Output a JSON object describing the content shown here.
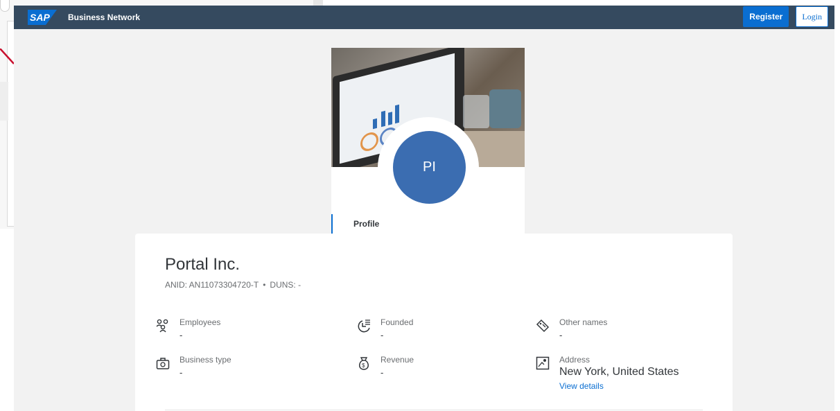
{
  "shellbar": {
    "logo_text": "SAP",
    "title": "Business Network",
    "register_label": "Register",
    "login_label": "Login",
    "background": "#354a5f",
    "accent": "#0a6ed1"
  },
  "profile": {
    "avatar_initials": "PI",
    "avatar_color": "#3b6db1",
    "tab_label": "Profile"
  },
  "company": {
    "name": "Portal Inc.",
    "anid_label": "ANID: AN11073304720-T",
    "separator": "•",
    "duns_label": "DUNS: -"
  },
  "fields": {
    "employees": {
      "label": "Employees",
      "value": "-",
      "icon": "employees-icon"
    },
    "founded": {
      "label": "Founded",
      "value": "-",
      "icon": "founded-icon"
    },
    "other_names": {
      "label": "Other names",
      "value": "-",
      "icon": "tag-icon"
    },
    "business_type": {
      "label": "Business type",
      "value": "-",
      "icon": "briefcase-icon"
    },
    "revenue": {
      "label": "Revenue",
      "value": "-",
      "icon": "money-bag-icon"
    },
    "address": {
      "label": "Address",
      "value": "New York, United States",
      "link": "View details",
      "icon": "map-icon"
    }
  }
}
